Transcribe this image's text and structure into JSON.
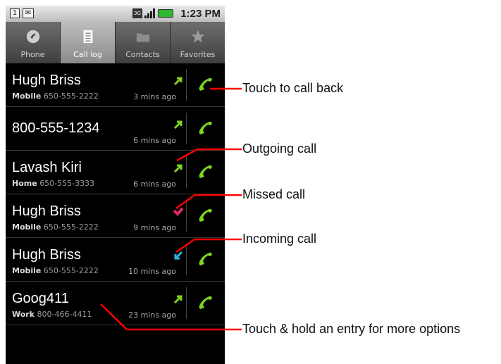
{
  "status_bar": {
    "left_icons": [
      "sim-icon",
      "mail-icon"
    ],
    "network": "3G",
    "time": "1:23 PM"
  },
  "tabs": [
    {
      "label": "Phone",
      "icon": "phone-icon",
      "active": false
    },
    {
      "label": "Call log",
      "icon": "call-log-icon",
      "active": true
    },
    {
      "label": "Contacts",
      "icon": "contacts-icon",
      "active": false
    },
    {
      "label": "Favorites",
      "icon": "star-icon",
      "active": false
    }
  ],
  "calls": [
    {
      "name": "Hugh Briss",
      "number_type": "Mobile",
      "number": "650-555-2222",
      "time": "3 mins ago",
      "call_type": "outgoing"
    },
    {
      "name": "800-555-1234",
      "number_type": "",
      "number": "",
      "time": "6 mins ago",
      "call_type": "outgoing"
    },
    {
      "name": "Lavash Kiri",
      "number_type": "Home",
      "number": "650-555-3333",
      "time": "6 mins ago",
      "call_type": "outgoing"
    },
    {
      "name": "Hugh Briss",
      "number_type": "Mobile",
      "number": "650-555-2222",
      "time": "9 mins ago",
      "call_type": "missed"
    },
    {
      "name": "Hugh Briss",
      "number_type": "Mobile",
      "number": "650-555-2222",
      "time": "10 mins ago",
      "call_type": "incoming"
    },
    {
      "name": "Goog411",
      "number_type": "Work",
      "number": "800-466-4411",
      "time": "23 mins ago",
      "call_type": "outgoing"
    }
  ],
  "annotations": {
    "call_back": "Touch to call back",
    "outgoing": "Outgoing call",
    "missed": "Missed call",
    "incoming": "Incoming call",
    "hold": "Touch & hold an entry for more options"
  },
  "colors": {
    "annotation_line": "#ff0000",
    "outgoing_arrow": "#7ed321",
    "incoming_arrow": "#29b6e8",
    "missed_icon": "#e8236a",
    "call_button": "#7ed321"
  }
}
